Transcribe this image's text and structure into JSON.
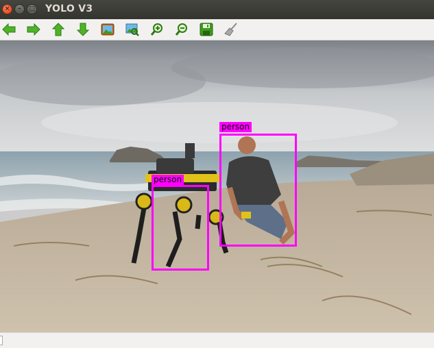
{
  "window": {
    "title": "YOLO V3",
    "close_glyph": "×",
    "min_glyph": "–",
    "max_glyph": "□"
  },
  "toolbar": {
    "buttons": [
      {
        "id": "back",
        "icon": "arrow-left-icon"
      },
      {
        "id": "forward",
        "icon": "arrow-right-icon"
      },
      {
        "id": "up",
        "icon": "arrow-up-icon"
      },
      {
        "id": "down",
        "icon": "arrow-down-icon"
      },
      {
        "id": "open-image",
        "icon": "image-icon"
      },
      {
        "id": "fit-image",
        "icon": "zoom-fit-icon"
      },
      {
        "id": "zoom-in",
        "icon": "zoom-in-icon"
      },
      {
        "id": "zoom-out",
        "icon": "zoom-out-icon"
      },
      {
        "id": "save",
        "icon": "save-icon"
      },
      {
        "id": "clear",
        "icon": "broom-icon"
      }
    ],
    "accent_green": "#3c9a1e"
  },
  "detections": [
    {
      "label": "person"
    },
    {
      "label": "person"
    }
  ],
  "colors": {
    "box": "#ff00ff",
    "titlebar": "#3c3b37"
  }
}
